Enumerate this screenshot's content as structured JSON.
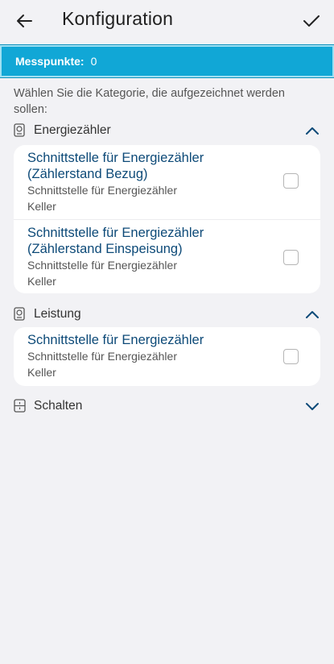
{
  "header": {
    "title": "Konfiguration"
  },
  "banner": {
    "label": "Messpunkte:",
    "value": "0"
  },
  "instruction": "Wählen Sie die Kategorie, die aufgezeichnet werden sollen:",
  "categories": [
    {
      "label": "Energiezähler",
      "expanded": true,
      "items": [
        {
          "name": "Schnittstelle für Energiezähler (Zählerstand Bezug)",
          "subtitle": "Schnittstelle für Energiezähler",
          "location": "Keller",
          "checked": false
        },
        {
          "name": "Schnittstelle für Energiezähler (Zählerstand Einspeisung)",
          "subtitle": "Schnittstelle für Energiezähler",
          "location": "Keller",
          "checked": false
        }
      ]
    },
    {
      "label": "Leistung",
      "expanded": true,
      "items": [
        {
          "name": "Schnittstelle für Energiezähler",
          "subtitle": "Schnittstelle für Energiezähler",
          "location": "Keller",
          "checked": false
        }
      ]
    },
    {
      "label": "Schalten",
      "expanded": false,
      "items": []
    }
  ],
  "colors": {
    "accent": "#11a7d6",
    "link": "#0d4a78",
    "background": "#f2f2f5"
  }
}
